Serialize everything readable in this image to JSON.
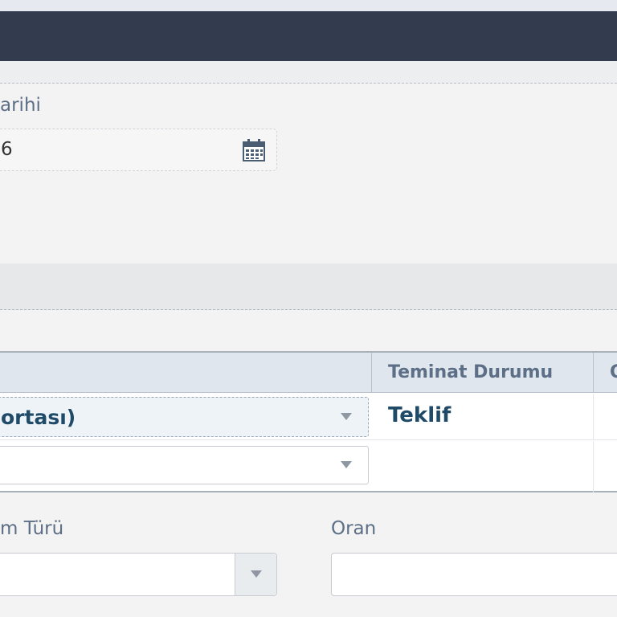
{
  "form": {
    "date_label": "arihi",
    "date_value": "6",
    "type_label": "m Türü",
    "ratio_label": "Oran"
  },
  "grid": {
    "columns": [
      "",
      "Teminat Durumu",
      "O"
    ],
    "rows": [
      {
        "product": "ortası)",
        "status": "Teklif"
      },
      {
        "product": "",
        "status": ""
      }
    ]
  }
}
